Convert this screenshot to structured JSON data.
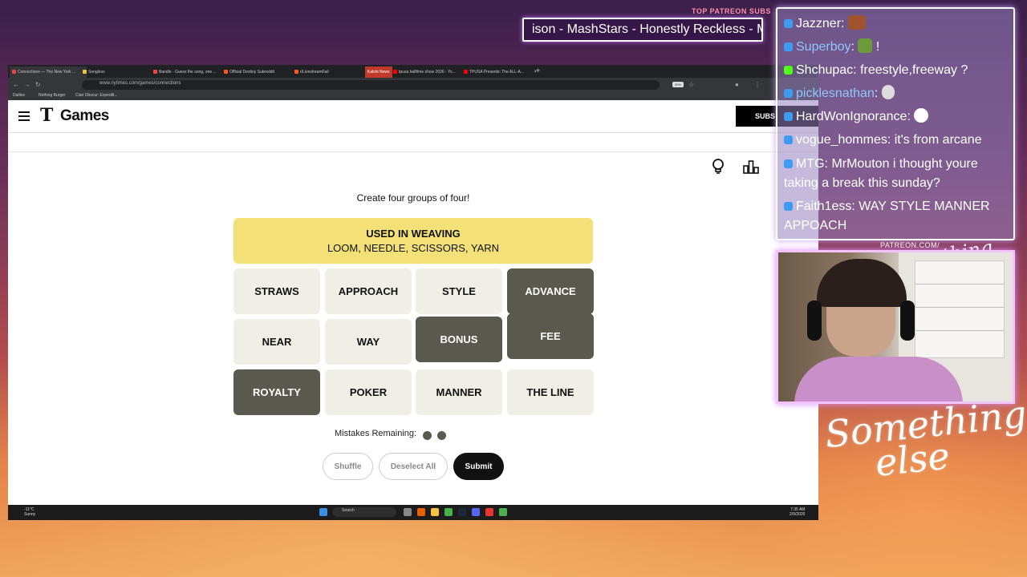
{
  "overlay": {
    "ticker_label": "TOP PATREON SUBS",
    "ticker_text": "ison - MashStars - Honestly Reckless - Mc",
    "patreon_label": "PATREON.COM/",
    "patreon_signature": "Anything Else",
    "signature": "Something else"
  },
  "browser": {
    "tabs": [
      {
        "label": "Connections — The New York ...",
        "color": "#e44"
      },
      {
        "label": "Songless",
        "color": "#f0c040"
      },
      {
        "label": "Bandle - Guess the song, one ...",
        "color": "#e44"
      },
      {
        "label": "Official Destiny Subreddit",
        "color": "#ff5722"
      },
      {
        "label": "r/LivestreamFail",
        "color": "#ff5722"
      },
      {
        "label": "Kalshi News",
        "color": "#fff"
      },
      {
        "label": "tpusa halftime show 2026 - Yo...",
        "color": "#f00"
      },
      {
        "label": "TPUSA Presents: The ALL-A...",
        "color": "#f00"
      }
    ],
    "url": "www.nytimes.com/games/connections",
    "zoom": "90%",
    "bookmarks": [
      "Dailies",
      "Nothing Burger",
      "Clair Obscur: Expediti..."
    ]
  },
  "nyt": {
    "logo_t": "T",
    "logo_games": "Games",
    "subscribe": "SUBS",
    "prompt": "Create four groups of four!",
    "solved": {
      "title": "USED IN WEAVING",
      "words": "LOOM, NEEDLE, SCISSORS, YARN",
      "color": "#f3e178"
    },
    "grid": [
      {
        "word": "STRAWS",
        "selected": false
      },
      {
        "word": "APPROACH",
        "selected": false
      },
      {
        "word": "STYLE",
        "selected": false
      },
      {
        "word": "ADVANCE",
        "selected": true
      },
      {
        "word": "NEAR",
        "selected": false
      },
      {
        "word": "WAY",
        "selected": false
      },
      {
        "word": "BONUS",
        "selected": true
      },
      {
        "word": "FEE",
        "selected": true
      },
      {
        "word": "ROYALTY",
        "selected": true
      },
      {
        "word": "POKER",
        "selected": false
      },
      {
        "word": "MANNER",
        "selected": false
      },
      {
        "word": "THE LINE",
        "selected": false
      }
    ],
    "mistakes_label": "Mistakes Remaining:",
    "mistakes_remaining": 2,
    "buttons": {
      "shuffle": "Shuffle",
      "deselect": "Deselect All",
      "submit": "Submit"
    }
  },
  "taskbar": {
    "weather_temp": "-11°C",
    "weather_desc": "Sunny",
    "search": "Search",
    "time": "7:35 AM",
    "date": "2/9/2026"
  },
  "chat": [
    {
      "user": "Jazzner",
      "msg": "",
      "badge": "tw",
      "emote": true
    },
    {
      "user": "Superboy",
      "msg": "!",
      "badge": "tw",
      "emote": true
    },
    {
      "user": "Shchupac",
      "msg": "freestyle,freeway ?",
      "badge": "kick",
      "emote": false
    },
    {
      "user": "picklesnathan",
      "msg": "",
      "badge": "tw",
      "emote": true
    },
    {
      "user": "HardWonIgnorance",
      "msg": "",
      "badge": "tw",
      "emote": true
    },
    {
      "user": "vogue_hommes",
      "msg": "it's from arcane",
      "badge": "tw",
      "emote": false
    },
    {
      "user": "MTG",
      "msg": "MrMouton i thought youre",
      "cont": "taking a break this sunday?",
      "badge": "tw",
      "emote": false
    },
    {
      "user": "Faith1ess",
      "msg": "WAY STYLE MANNER",
      "cont": "APPOACH",
      "badge": "tw",
      "emote": false
    }
  ]
}
